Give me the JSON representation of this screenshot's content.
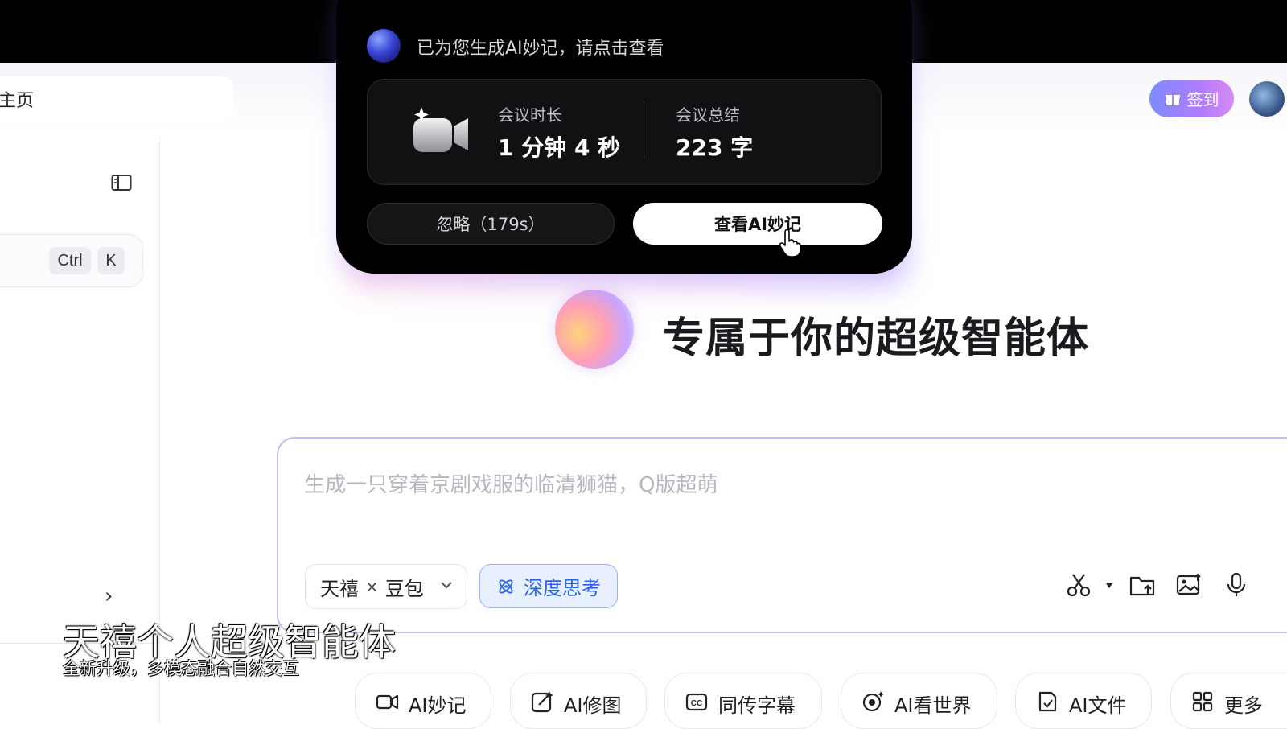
{
  "header": {
    "home_label": "主页",
    "checkin_label": "签到"
  },
  "sidebar": {
    "shortcut_keys": [
      "Ctrl",
      "K"
    ],
    "expand_chevron": "›"
  },
  "popup": {
    "title": "已为您生成AI妙记，请点击查看",
    "duration_label": "会议时长",
    "duration_value": "1 分钟 4 秒",
    "summary_label": "会议总结",
    "summary_value": "223 字",
    "ignore_button": "忽略（179s）",
    "view_button": "查看AI妙记"
  },
  "hero": {
    "title": "专属于你的超级智能体"
  },
  "composer": {
    "placeholder": "生成一只穿着京剧戏服的临清狮猫，Q版超萌",
    "model_left": "天禧",
    "model_sep": "×",
    "model_right": "豆包",
    "deep_think_label": "深度思考",
    "tools": [
      "scissors-icon",
      "folder-upload-icon",
      "image-upload-icon",
      "microphone-icon"
    ]
  },
  "caption": {
    "main": "天禧个人超级智能体",
    "sub": "全新升级，多模态融合自然交互"
  },
  "quick_actions": [
    {
      "label": "AI妙记",
      "icon": "video-note-icon"
    },
    {
      "label": "AI修图",
      "icon": "image-edit-icon"
    },
    {
      "label": "同传字幕",
      "icon": "cc-icon"
    },
    {
      "label": "AI看世界",
      "icon": "eye-sparkle-icon"
    },
    {
      "label": "AI文件",
      "icon": "file-icon"
    },
    {
      "label": "更多",
      "icon": "grid-icon"
    }
  ],
  "colors": {
    "accent_blue": "#2c63e8",
    "checkin_gradient_start": "#7d8cff",
    "checkin_gradient_end": "#d58af0",
    "popup_bg": "#000000"
  }
}
